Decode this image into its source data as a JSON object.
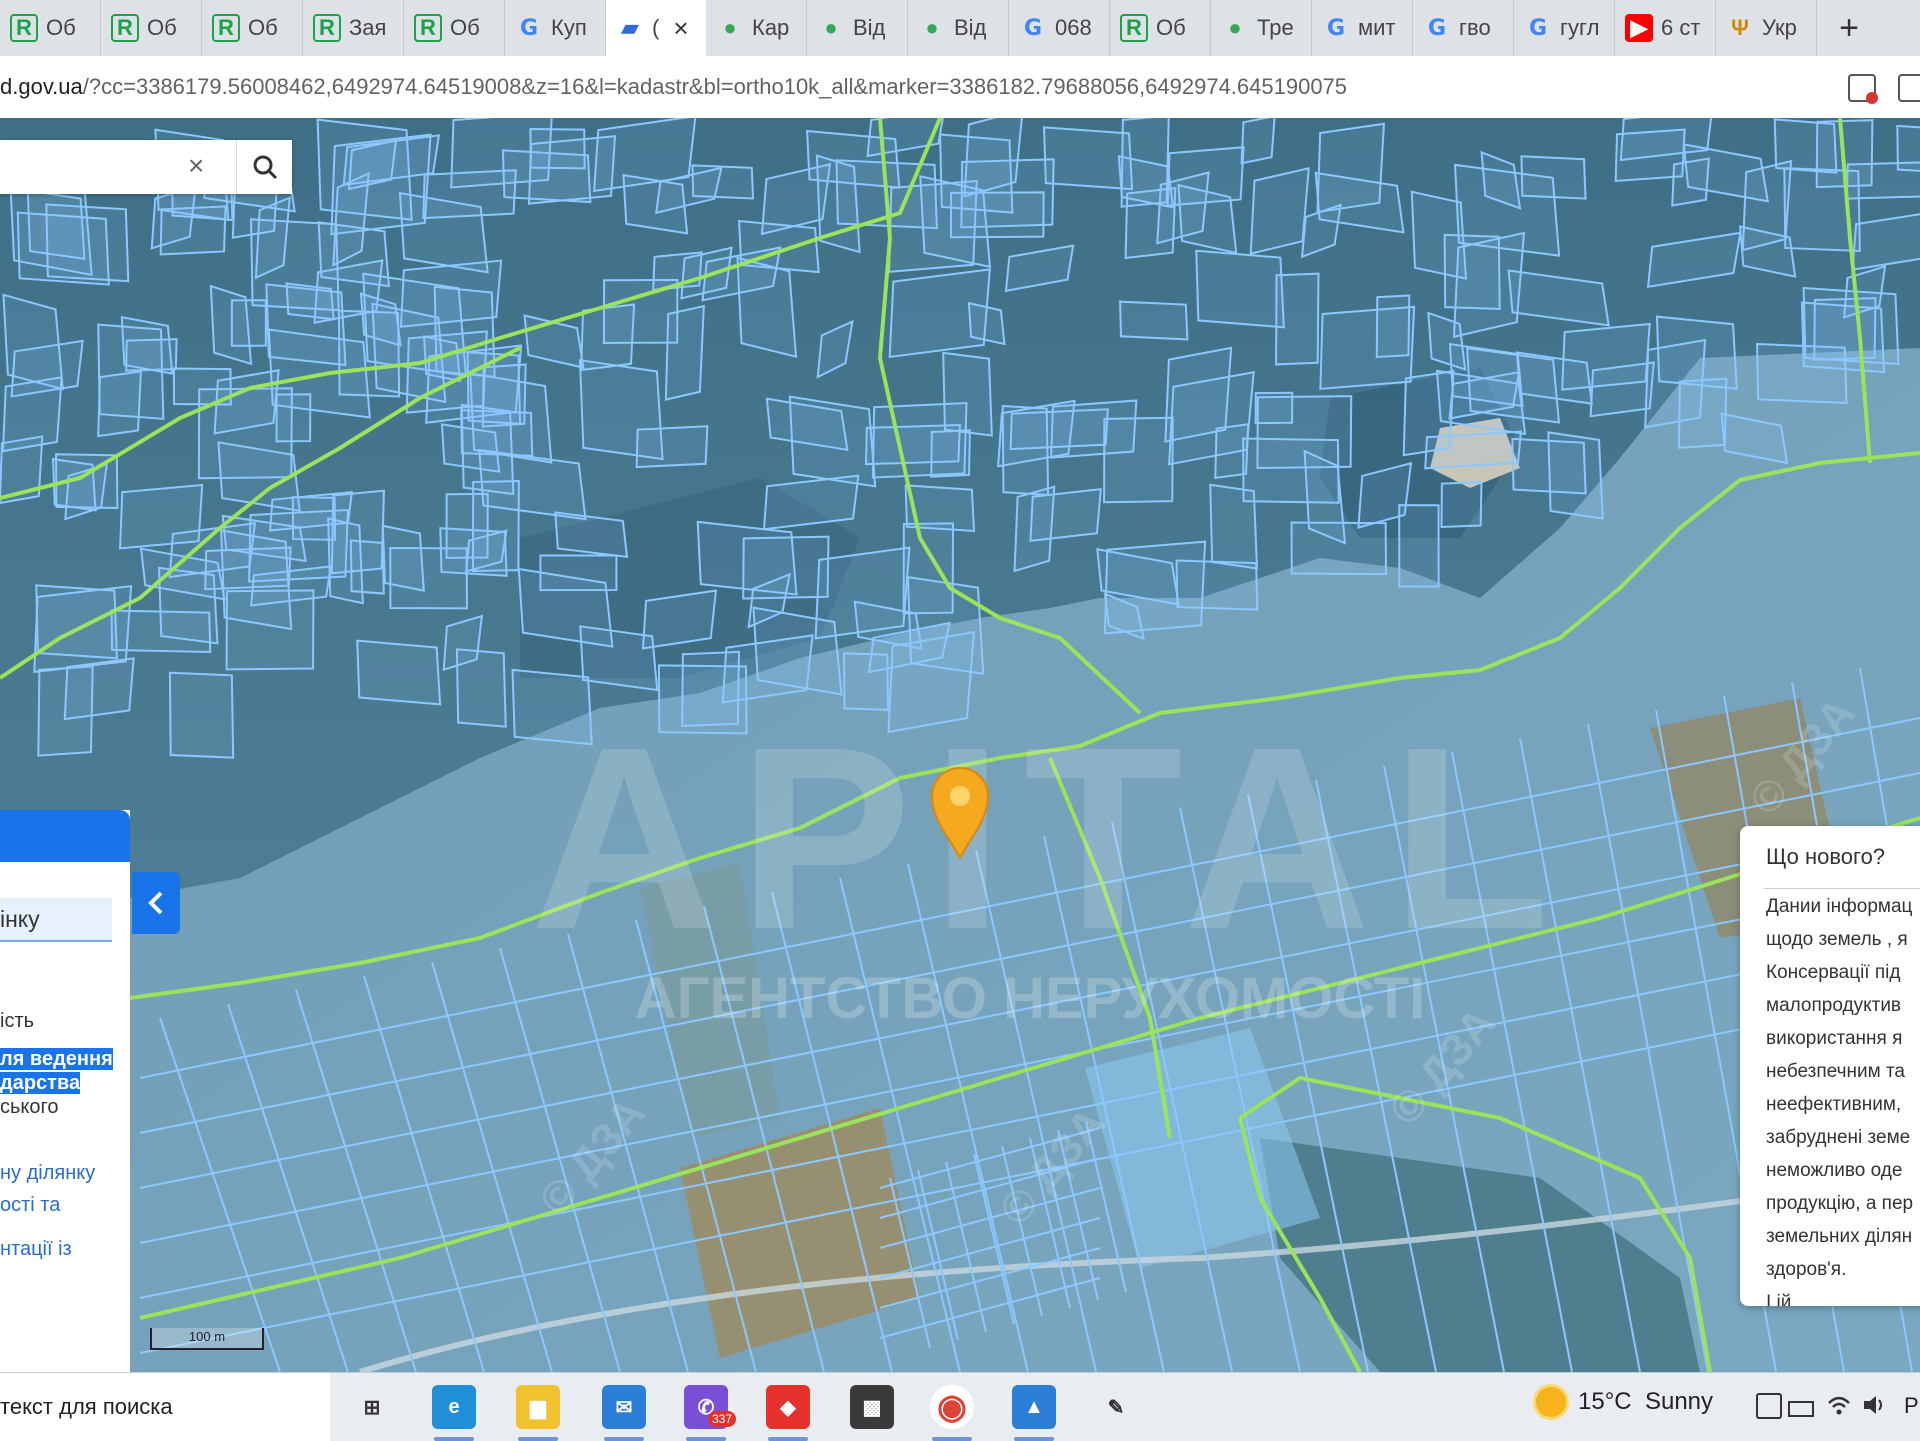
{
  "browser": {
    "tabs": [
      {
        "label": "Об",
        "icon": "r-app-icon"
      },
      {
        "label": "Об",
        "icon": "r-app-icon"
      },
      {
        "label": "Об",
        "icon": "r-app-icon"
      },
      {
        "label": "Зая",
        "icon": "r-app-icon"
      },
      {
        "label": "Об",
        "icon": "r-app-icon"
      },
      {
        "label": "Куп",
        "icon": "google-icon"
      },
      {
        "label": "(",
        "icon": "ua-flag-icon",
        "active": true
      },
      {
        "label": "Кар",
        "icon": "maps-pin-icon"
      },
      {
        "label": "Від",
        "icon": "maps-pin-icon"
      },
      {
        "label": "Від",
        "icon": "maps-pin-icon"
      },
      {
        "label": "068",
        "icon": "google-icon"
      },
      {
        "label": "Об",
        "icon": "r-app-icon"
      },
      {
        "label": "Тре",
        "icon": "maps-pin-icon"
      },
      {
        "label": "мит",
        "icon": "google-icon"
      },
      {
        "label": "гво",
        "icon": "google-icon"
      },
      {
        "label": "гугл",
        "icon": "google-icon"
      },
      {
        "label": "6 ст",
        "icon": "youtube-icon"
      },
      {
        "label": "Укр",
        "icon": "ukr-trident-icon"
      }
    ],
    "tab_close": "×",
    "new_tab": "+",
    "url_host": "d.gov.ua",
    "url_rest": "/?cc=3386179.56008462,6492974.64519008&z=16&l=kadastr&bl=ortho10k_all&marker=3386182.79688056,6492974.645190075"
  },
  "map": {
    "search": {
      "placeholder": "",
      "clear": "×",
      "button_icon": "search-icon"
    },
    "watermark_main": "APITAL",
    "watermark_sub": "АГЕНТСТВО НЕРУХОМОСТІ",
    "dza_marks": [
      "© ДЗА",
      "© ДЗА",
      "© ДЗА",
      "© ДЗА"
    ],
    "scale_label": "100 m",
    "colors": {
      "parcel_stroke": "#8cc8ff",
      "boundary": "#9be35a",
      "marker": "#f6a81e"
    }
  },
  "left_panel": {
    "collapse_icon": "‹",
    "field_text": "інку",
    "lines": [
      {
        "text": "ість",
        "style": "plain"
      },
      {
        "text": "ля ведення",
        "style": "highlight"
      },
      {
        "text": "дарства",
        "style": "highlight"
      },
      {
        "text": "ського",
        "style": "plain"
      },
      {
        "text": "ну ділянку",
        "style": "link"
      },
      {
        "text": "ості та",
        "style": "link"
      },
      {
        "text": "нтації із",
        "style": "link"
      }
    ]
  },
  "whats_new": {
    "title": "Що нового?",
    "lines": [
      "Дании інформац",
      "щодо земель , я",
      "Консервації під",
      "малопродуктив",
      "використання я",
      "небезпечним та",
      "неефективним,",
      "забруднені земе",
      "неможливо оде",
      "продукцію, а пер",
      "земельних ділян",
      "здоров'я.",
      "І        ій"
    ]
  },
  "taskbar": {
    "search_text": "текст для поиска",
    "apps": [
      "task-view-icon",
      "edge-icon",
      "file-explorer-icon",
      "mail-icon",
      "viber-icon",
      "anydesk-icon",
      "winbox-icon",
      "chrome-icon",
      "photos-icon",
      "paint-icon"
    ],
    "viber_badge": "337",
    "weather_temp": "15°C",
    "weather_desc": "Sunny",
    "lang": "Р"
  }
}
